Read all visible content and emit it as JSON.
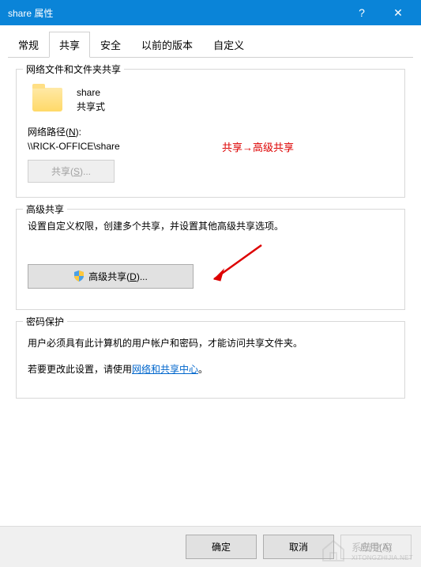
{
  "window": {
    "title": "share 属性",
    "help": "?",
    "close": "✕"
  },
  "tabs": [
    {
      "label": "常规"
    },
    {
      "label": "共享"
    },
    {
      "label": "安全"
    },
    {
      "label": "以前的版本"
    },
    {
      "label": "自定义"
    }
  ],
  "group1": {
    "title": "网络文件和文件夹共享",
    "folder_name": "share",
    "share_status": "共享式",
    "path_label": "网络路径(",
    "path_label_u": "N",
    "path_label_end": "):",
    "path_value": "\\\\RICK-OFFICE\\share",
    "share_btn": "共享(",
    "share_btn_u": "S",
    "share_btn_end": ")..."
  },
  "annotation1": "共享→高级共享",
  "group2": {
    "title": "高级共享",
    "desc": "设置自定义权限，创建多个共享，并设置其他高级共享选项。",
    "btn_prefix": "高级共享(",
    "btn_u": "D",
    "btn_end": ")...",
    "shield_name": "shield-icon"
  },
  "group3": {
    "title": "密码保护",
    "desc1": "用户必须具有此计算机的用户帐户和密码，才能访问共享文件夹。",
    "desc2a": "若要更改此设置，请使用",
    "link": "网络和共享中心",
    "desc2b": "。"
  },
  "buttons": {
    "ok": "确定",
    "cancel": "取消",
    "apply": "应用(A)"
  },
  "watermark": {
    "line1": "系统之家",
    "line2": "XITONGZHIJIA.NET"
  }
}
